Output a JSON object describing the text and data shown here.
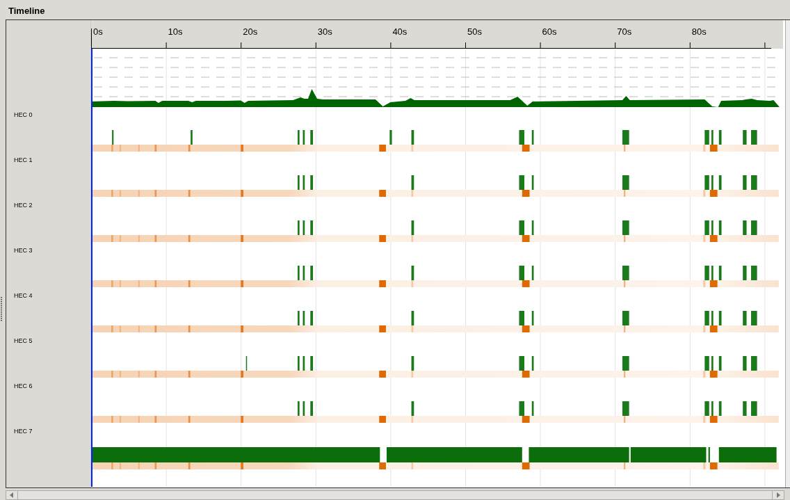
{
  "title": "Timeline",
  "ruler": {
    "ticks": [
      "0s",
      "10s",
      "20s",
      "30s",
      "40s",
      "50s",
      "60s",
      "70s",
      "80s"
    ]
  },
  "hecs": [
    {
      "label": "HEC 0",
      "kind": "sparse"
    },
    {
      "label": "HEC 1",
      "kind": "sparse"
    },
    {
      "label": "HEC 2",
      "kind": "sparse"
    },
    {
      "label": "HEC 3",
      "kind": "sparse"
    },
    {
      "label": "HEC 4",
      "kind": "sparse"
    },
    {
      "label": "HEC 5",
      "kind": "sparse"
    },
    {
      "label": "HEC 6",
      "kind": "sparse"
    },
    {
      "label": "HEC 7",
      "kind": "busy"
    }
  ]
}
